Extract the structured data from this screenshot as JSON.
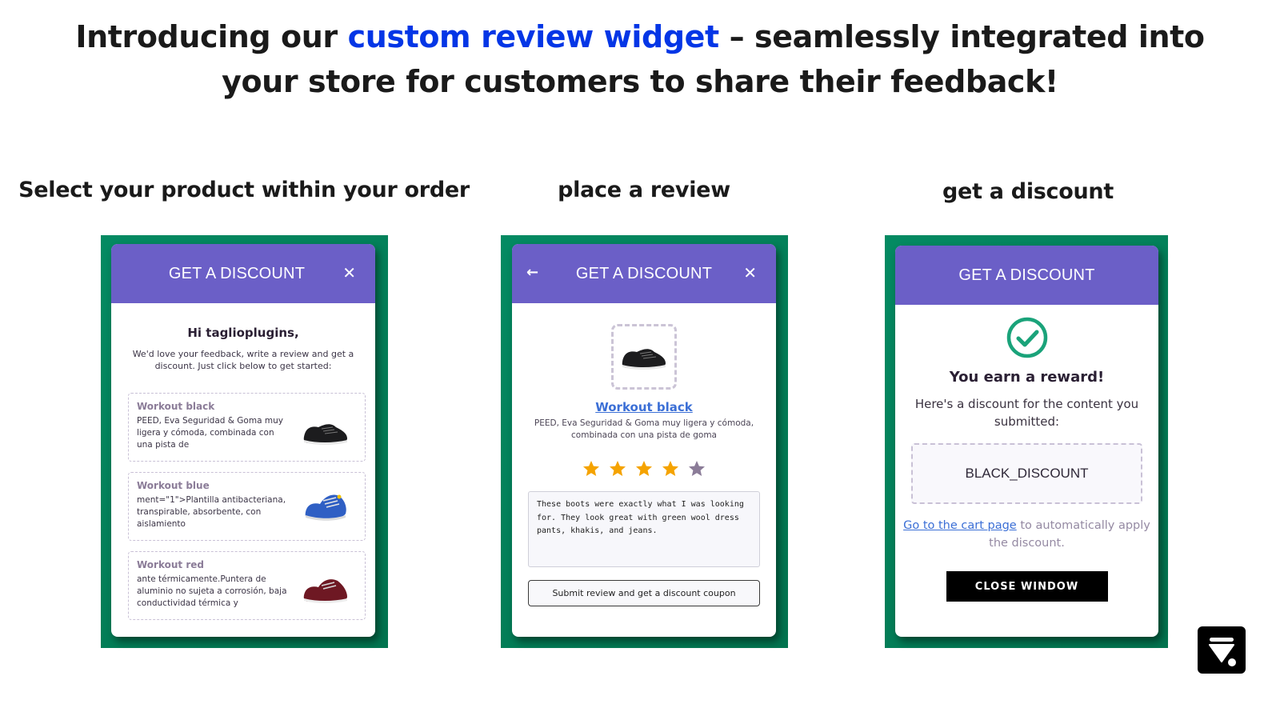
{
  "headline": {
    "prefix": "Introducing our ",
    "accent": "custom review widget",
    "suffix_line1": " – seamlessly integrated into",
    "line2": "your store for customers to share their feedback!",
    "accent_color": "#0436e6"
  },
  "steps": [
    {
      "title": "Select your product within your order"
    },
    {
      "title": "place a review"
    },
    {
      "title": "get a discount"
    }
  ],
  "colors": {
    "frame_green": "#03805c",
    "header_purple": "#6b5fc7",
    "star_active": "#f5a300",
    "star_inactive": "#8b7c98",
    "check_green": "#1aa37a",
    "link_blue": "#3b6fd6"
  },
  "widget_select": {
    "header_title": "GET A DISCOUNT",
    "close_icon": "close-icon",
    "greeting": "Hi taglioplugins,",
    "intro": "We'd love your feedback, write a review and get a discount. Just click below to get started:",
    "products": [
      {
        "name": "Workout black",
        "description": "PEED, Eva Seguridad & Goma muy ligera y cómoda, combinada con una pista de",
        "image": "black-sneaker"
      },
      {
        "name": "Workout blue",
        "description": "ment=\"1\">Plantilla antibacteriana, transpirable, absorbente, con aislamiento",
        "image": "blue-sneaker"
      },
      {
        "name": "Workout red",
        "description": "ante térmicamente.Puntera de aluminio no sujeta a corrosión, baja conductividad térmica y",
        "image": "red-sneaker"
      }
    ]
  },
  "widget_review": {
    "header_title": "GET A DISCOUNT",
    "back_icon": "arrow-left-icon",
    "close_icon": "close-icon",
    "product_name": "Workout black",
    "product_description": "PEED, Eva Seguridad & Goma muy ligera y cómoda, combinada con una pista de goma",
    "rating": 4,
    "rating_max": 5,
    "review_text": "These boots were exactly what I was looking for. They look great with green wool dress pants, khakis, and jeans.",
    "submit_label": "Submit review and get a discount coupon"
  },
  "widget_discount": {
    "header_title": "GET A DISCOUNT",
    "success_icon": "check-circle-icon",
    "title": "You earn a reward!",
    "subtitle": "Here's a discount for the content you submitted:",
    "discount_code": "BLACK_DISCOUNT",
    "cart_link": "Go to the cart page",
    "cart_suffix": " to automatically apply the discount.",
    "close_label": "CLOSE WINDOW"
  }
}
